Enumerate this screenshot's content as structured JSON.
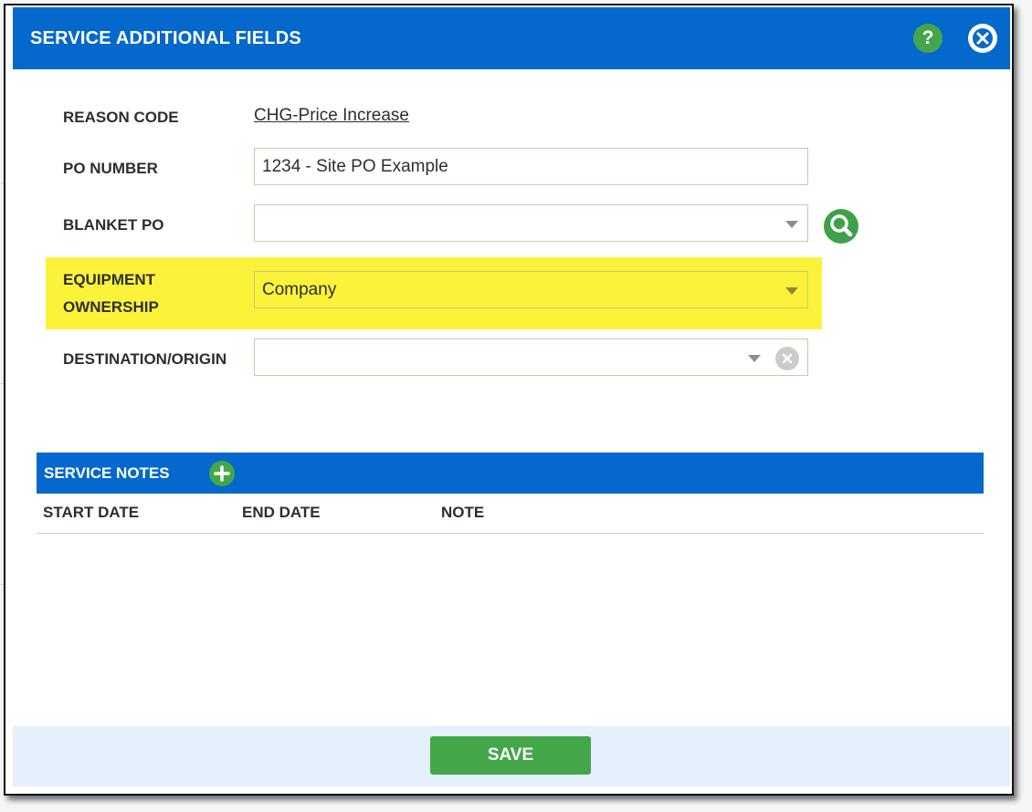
{
  "dialog": {
    "title": "SERVICE ADDITIONAL FIELDS",
    "help_label": "?",
    "header_color": "#0468cc"
  },
  "form": {
    "reason_code": {
      "label": "REASON CODE",
      "value": "CHG-Price Increase"
    },
    "po_number": {
      "label": "PO NUMBER",
      "value": "1234 - Site PO Example"
    },
    "blanket_po": {
      "label": "BLANKET PO",
      "value": ""
    },
    "equipment_ownership": {
      "label_line1": "EQUIPMENT",
      "label_line2": "OWNERSHIP",
      "value": "Company",
      "highlight_color": "#fdf23a"
    },
    "destination_origin": {
      "label": "DESTINATION/ORIGIN",
      "value": ""
    }
  },
  "service_notes": {
    "title": "SERVICE NOTES",
    "columns": [
      "START DATE",
      "END DATE",
      "NOTE"
    ],
    "rows": []
  },
  "footer": {
    "save_label": "SAVE",
    "save_color": "#43a74a"
  },
  "icons": {
    "help": "help-icon",
    "close": "close-icon",
    "search": "search-icon",
    "clear": "clear-icon",
    "add": "add-icon",
    "dropdown": "chevron-down-icon"
  }
}
